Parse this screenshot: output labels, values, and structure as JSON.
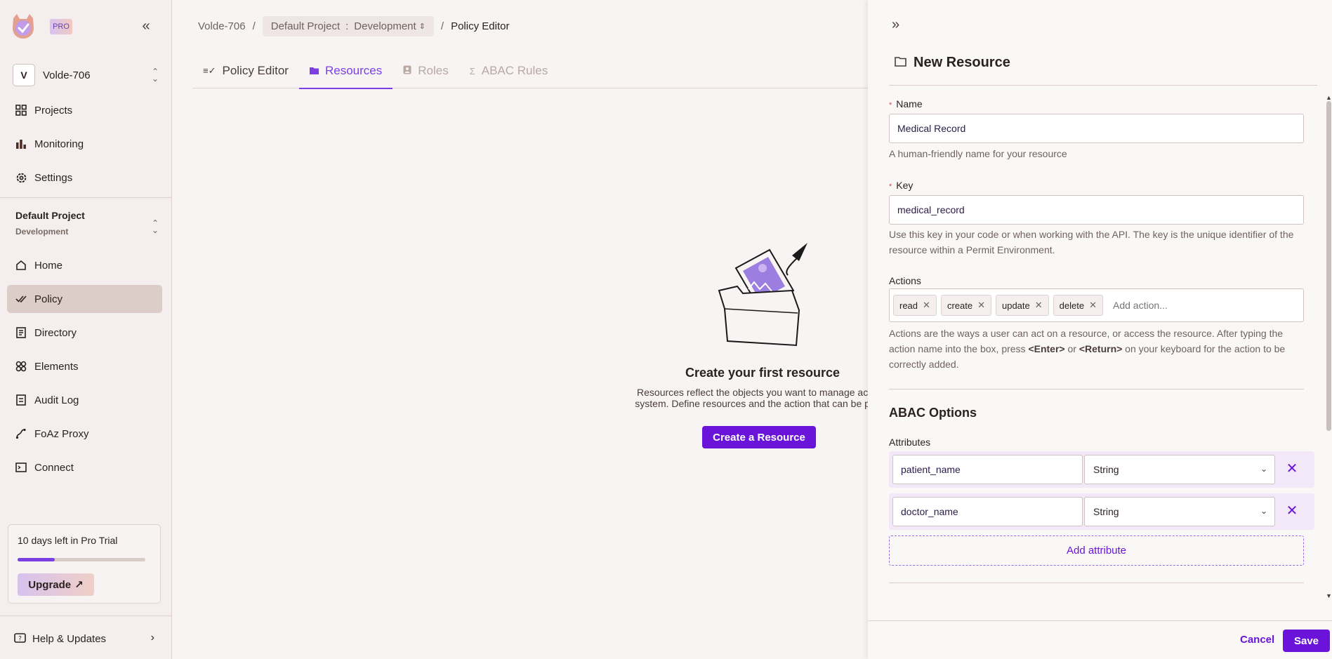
{
  "sidebar": {
    "pro_badge": "PRO",
    "org": {
      "avatar_letter": "V",
      "name": "Volde-706"
    },
    "top_items": [
      {
        "label": "Projects",
        "icon": "grid-icon"
      },
      {
        "label": "Monitoring",
        "icon": "bar-chart-icon"
      },
      {
        "label": "Settings",
        "icon": "gear-icon"
      }
    ],
    "project": {
      "name": "Default Project",
      "env": "Development"
    },
    "items": [
      {
        "label": "Home",
        "icon": "home-icon"
      },
      {
        "label": "Policy",
        "icon": "double-check-icon"
      },
      {
        "label": "Directory",
        "icon": "directory-icon"
      },
      {
        "label": "Elements",
        "icon": "elements-icon"
      },
      {
        "label": "Audit Log",
        "icon": "document-icon"
      },
      {
        "label": "FoAz Proxy",
        "icon": "proxy-icon"
      },
      {
        "label": "Connect",
        "icon": "terminal-icon"
      }
    ],
    "trial": {
      "text": "10 days left in Pro Trial",
      "progress": 0.29,
      "upgrade_label": "Upgrade"
    },
    "help_label": "Help & Updates"
  },
  "breadcrumb": {
    "org": "Volde-706",
    "project": "Default Project",
    "separator_colon": ":",
    "env": "Development",
    "current": "Policy Editor",
    "sep": "/"
  },
  "tabs": [
    {
      "label": "Policy Editor",
      "icon": "policy-editor-icon"
    },
    {
      "label": "Resources",
      "icon": "folder-icon"
    },
    {
      "label": "Roles",
      "icon": "roles-icon"
    },
    {
      "label": "ABAC Rules",
      "icon": "sigma-icon"
    }
  ],
  "empty_state": {
    "title": "Create your first resource",
    "description_line1": "Resources reflect the objects you want to manage access",
    "description_line2": "system. Define resources and the action that can be perfor",
    "button": "Create a Resource"
  },
  "drawer": {
    "title": "New Resource",
    "name": {
      "label": "Name",
      "value": "Medical Record",
      "help": "A human-friendly name for your resource"
    },
    "key": {
      "label": "Key",
      "value": "medical_record",
      "help": "Use this key in your code or when working with the API. The key is the unique identifier of the resource within a Permit Environment."
    },
    "actions": {
      "label": "Actions",
      "tags": [
        "read",
        "create",
        "update",
        "delete"
      ],
      "placeholder": "Add action...",
      "help_before": "Actions are the ways a user can act on a resource, or access the resource. After typing the action name into the box, press ",
      "help_key1": "<Enter>",
      "help_or": " or ",
      "help_key2": "<Return>",
      "help_after": " on your keyboard for the action to be correctly added."
    },
    "abac": {
      "title": "ABAC Options",
      "attributes_label": "Attributes",
      "attributes": [
        {
          "name": "patient_name",
          "type": "String"
        },
        {
          "name": "doctor_name",
          "type": "String"
        }
      ],
      "add_label": "Add attribute"
    },
    "cancel_label": "Cancel",
    "save_label": "Save"
  },
  "colors": {
    "accent": "#6a14d9",
    "active_nav": "#dccdc9",
    "tab_active": "#7b3fe4"
  }
}
